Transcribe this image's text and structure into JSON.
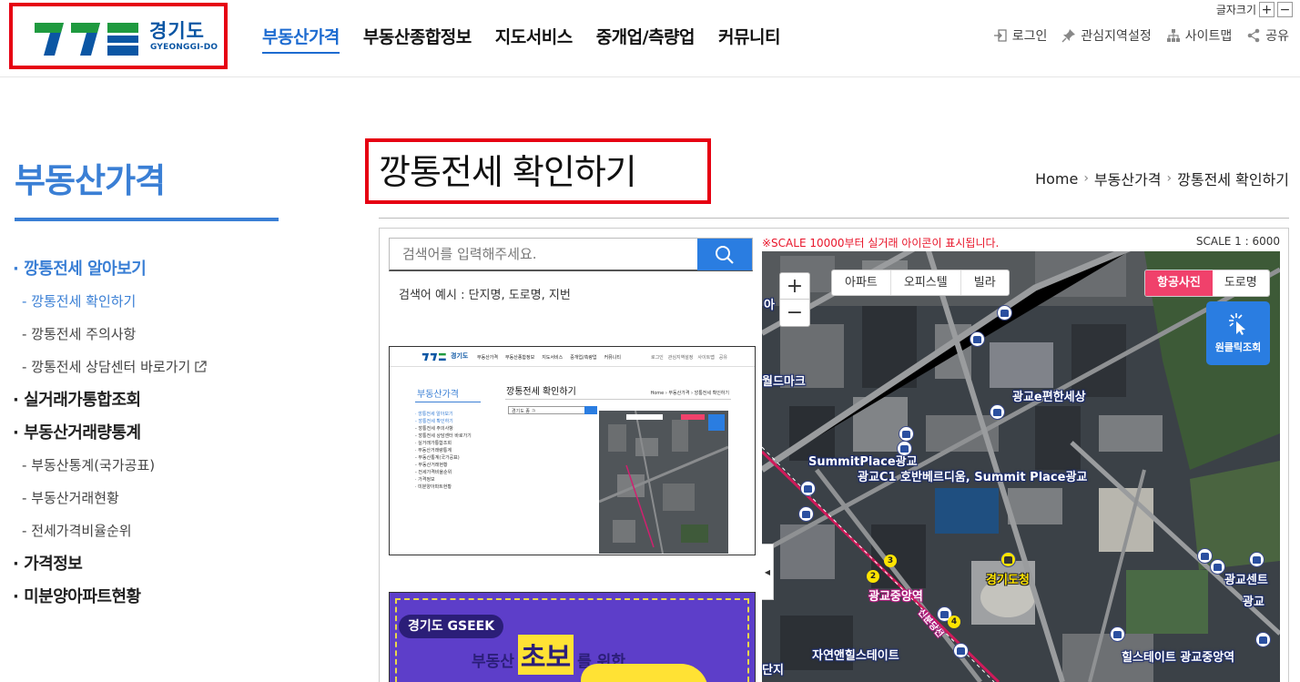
{
  "header": {
    "logo_text": "경기도",
    "logo_sub": "GYEONGGI-DO",
    "gnb": [
      "부동산가격",
      "부동산종합정보",
      "지도서비스",
      "중개업/측량업",
      "커뮤니티"
    ],
    "fontsize_label": "글자크기",
    "fontsize_plus": "+",
    "fontsize_minus": "−",
    "util": [
      "로그인",
      "관심지역설정",
      "사이트맵",
      "공유"
    ]
  },
  "sidebar": {
    "title": "부동산가격",
    "menu": [
      {
        "label": "깡통전세 알아보기",
        "level": 1
      },
      {
        "label": "깡통전세 확인하기",
        "level": 2
      },
      {
        "label": "깡통전세 주의사항",
        "level": 2
      },
      {
        "label": "깡통전세 상담센터 바로가기",
        "level": 2
      },
      {
        "label": "실거래가통합조회",
        "level": 1
      },
      {
        "label": "부동산거래량통계",
        "level": 1
      },
      {
        "label": "부동산통계(국가공표)",
        "level": 2
      },
      {
        "label": "부동산거래현황",
        "level": 2
      },
      {
        "label": "전세가격비율순위",
        "level": 2
      },
      {
        "label": "가격정보",
        "level": 1
      },
      {
        "label": "미분양아파트현황",
        "level": 1
      }
    ]
  },
  "page": {
    "title": "깡통전세 확인하기",
    "breadcrumb": [
      "Home",
      "부동산가격",
      "깡통전세 확인하기"
    ]
  },
  "search": {
    "placeholder": "검색어를 입력해주세요.",
    "hint": "검색어 예시 : 단지명, 도로명, 지번"
  },
  "mini": {
    "logo_text": "경기도",
    "gnb": [
      "부동산가격",
      "부동산종합정보",
      "지도서비스",
      "중개업/측량업",
      "커뮤니티"
    ],
    "util": [
      "로그인",
      "관심지역설정",
      "사이트맵",
      "공유"
    ],
    "side_title": "부동산가격",
    "side": [
      "· 깡통전세 알아보기",
      "- 깡통전세 확인하기",
      "- 깡통전세 주의사항",
      "- 깡통전세 상담센터 바로가기",
      "· 실거래가통합조회",
      "· 부동산거래량통계",
      "- 부동산통계(국가공표)",
      "- 부동산거래현황",
      "- 전세가격비율순위",
      "· 가격정보",
      "· 미분양아파트현황"
    ],
    "title": "깡통전세 확인하기",
    "breadcrumb": "Home › 부동산가격 › 깡통전세 확인하기",
    "search_value": "경기도 종 ㅋ"
  },
  "banner": {
    "tag": "경기도 GSEEK",
    "line1_a": "부동산",
    "line1_b": "초보",
    "line1_c": "를 위한"
  },
  "map": {
    "note": "※SCALE 10000부터 실거래 아이콘이 표시됩니다.",
    "scale": "SCALE 1 : 6000",
    "zoom_in": "+",
    "zoom_out": "−",
    "type_tabs": [
      "아파트",
      "오피스텔",
      "빌라"
    ],
    "view_tabs": [
      "항공사진",
      "도로명"
    ],
    "oneclick": "원클릭조회",
    "collapse": "◀",
    "labels": {
      "l1": "월드마크",
      "l2": "광교e편한세상",
      "l3": "SummitPlace광교",
      "l4": "광교C1 호반베르디움, Summit Place광교",
      "l5": "경기도청",
      "l6": "광교중앙역",
      "l7": "광교센트",
      "l8": "광교",
      "l9": "자연앤힐스테이트",
      "l10": "힐스테이트 광교중앙역",
      "l11": "단지",
      "l12": "아",
      "l13": "신분당선"
    },
    "stations": [
      "2",
      "3",
      "4"
    ]
  },
  "colors": {
    "brand_blue": "#1d6bd0",
    "accent_red": "#e60012",
    "search_blue": "#2a7de1",
    "aerial_pink": "#f0416b"
  }
}
